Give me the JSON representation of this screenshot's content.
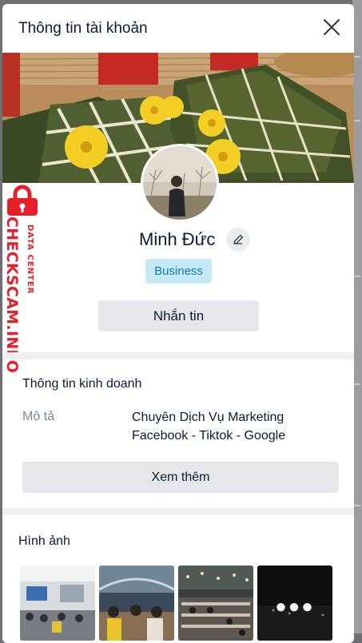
{
  "modal": {
    "title": "Thông tin tài khoản",
    "close_icon": "close-icon"
  },
  "profile": {
    "name": "Minh Đức",
    "edit_icon": "pencil-icon",
    "badge": "Business",
    "message_label": "Nhắn tin"
  },
  "watermark": {
    "main_text": "CHECKSCAM.INFO",
    "sub_text": "DATA CENTER",
    "icon": "lock-icon",
    "color": "#e5202a"
  },
  "business_info": {
    "title": "Thông tin kinh doanh",
    "description_label": "Mô tả",
    "description_line1": "Chuyên Dịch Vụ Marketing",
    "description_line2": "Facebook - Tiktok - Google",
    "more_label": "Xem thêm"
  },
  "photos": {
    "title": "Hình ảnh",
    "more_icon": "ellipsis-icon"
  },
  "colors": {
    "badge_bg": "#c6e9f6",
    "badge_text": "#0a7ab0",
    "button_bg": "#e5e7eb",
    "text_primary": "#081c36",
    "text_secondary": "#7589a3"
  }
}
